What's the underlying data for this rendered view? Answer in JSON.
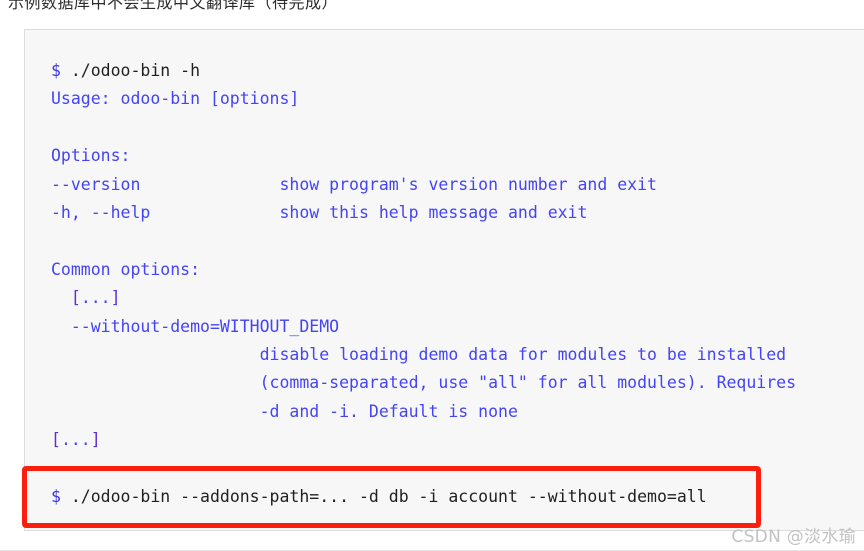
{
  "caption": {
    "text": "示例数据库中不会生成中文翻译库（待完成）"
  },
  "code_block": {
    "background_color": "#f7f7f8",
    "border_color": "#dcdcdc",
    "lines": [
      {
        "id": "cmd-help",
        "segments": [
          {
            "text": "$",
            "style": "prompt"
          },
          {
            "text": " ./odoo-bin -h",
            "style": "plain"
          }
        ]
      },
      {
        "id": "usage",
        "segments": [
          {
            "text": "Usage: odoo-bin [options]",
            "style": "blue"
          }
        ]
      },
      {
        "id": "blank-1",
        "segments": [
          {
            "text": " ",
            "style": "blank"
          }
        ]
      },
      {
        "id": "options-header",
        "segments": [
          {
            "text": "Options:",
            "style": "blue"
          }
        ]
      },
      {
        "id": "opt-version",
        "segments": [
          {
            "text": "--version              show program's version number and exit",
            "style": "blue"
          }
        ]
      },
      {
        "id": "opt-help",
        "segments": [
          {
            "text": "-h, --help             show this help message and exit",
            "style": "blue"
          }
        ]
      },
      {
        "id": "blank-2",
        "segments": [
          {
            "text": " ",
            "style": "blank"
          }
        ]
      },
      {
        "id": "common-options",
        "segments": [
          {
            "text": "Common options:",
            "style": "blue"
          }
        ]
      },
      {
        "id": "ellipsis-1",
        "segments": [
          {
            "text": "  [",
            "style": "violet"
          },
          {
            "text": "...",
            "style": "blue"
          },
          {
            "text": "]",
            "style": "violet"
          }
        ]
      },
      {
        "id": "opt-without-demo",
        "segments": [
          {
            "text": "  --without-demo=WITHOUT_DEMO",
            "style": "blue"
          }
        ]
      },
      {
        "id": "desc-line-1",
        "segments": [
          {
            "text": "                     disable loading demo data for modules to be installed",
            "style": "blue"
          }
        ]
      },
      {
        "id": "desc-line-2",
        "segments": [
          {
            "text": "                     (comma-separated, use \"all\" for all modules). Requires",
            "style": "blue"
          }
        ]
      },
      {
        "id": "desc-line-3",
        "segments": [
          {
            "text": "                     -d and -i. Default is none",
            "style": "blue"
          }
        ]
      },
      {
        "id": "ellipsis-2",
        "segments": [
          {
            "text": "[",
            "style": "violet"
          },
          {
            "text": "...",
            "style": "blue"
          },
          {
            "text": "]",
            "style": "violet"
          }
        ]
      },
      {
        "id": "blank-3",
        "segments": [
          {
            "text": " ",
            "style": "blank"
          }
        ]
      },
      {
        "id": "cmd-install",
        "segments": [
          {
            "text": "$",
            "style": "prompt"
          },
          {
            "text": " ./odoo-bin --addons-path=... -d db -i account --without-demo=all",
            "style": "plain"
          }
        ]
      }
    ]
  },
  "annotation": {
    "highlight_color": "#fb1f10",
    "highlighted_line": "$ ./odoo-bin --addons-path=... -d db -i account --without-demo=all"
  },
  "watermark": {
    "text": "CSDN @淡水瑜"
  },
  "colors": {
    "prompt": "#3a35e0",
    "plain": "#1f1f1f",
    "blue": "#4444f4",
    "violet": "#5a2fd6",
    "red": "#fb1f10",
    "watermark": "#c2c2c2"
  }
}
